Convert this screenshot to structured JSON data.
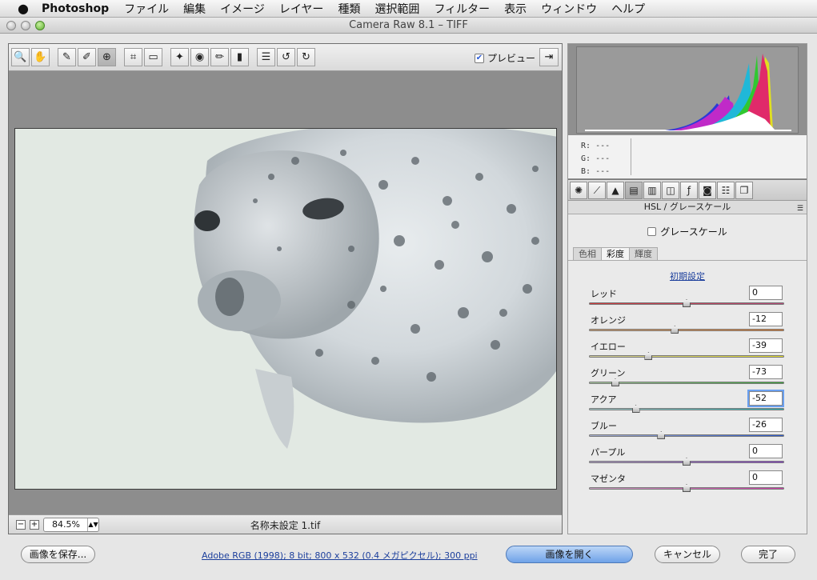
{
  "menubar": {
    "apple": "",
    "app_name": "Photoshop",
    "items": [
      "ファイル",
      "編集",
      "イメージ",
      "レイヤー",
      "種類",
      "選択範囲",
      "フィルター",
      "表示",
      "ウィンドウ",
      "ヘルプ"
    ]
  },
  "window": {
    "title": "Camera Raw 8.1  –  TIFF"
  },
  "toolbar": {
    "preview_label": "プレビュー",
    "preview_checked": true,
    "tools": [
      "zoom-tool",
      "hand-tool",
      "white-balance-tool",
      "color-sampler-tool",
      "targeted-adjustment-tool",
      "crop-tool",
      "straighten-tool",
      "spot-removal-tool",
      "red-eye-tool",
      "adjustment-brush-tool",
      "graduated-filter-tool",
      "radial-filter-tool",
      "preferences",
      "rotate-ccw",
      "rotate-cw"
    ]
  },
  "status": {
    "zoom": "84.5%",
    "filename": "名称未設定 1.tif"
  },
  "readout": {
    "r_label": "R:",
    "g_label": "G:",
    "b_label": "B:",
    "r": "---",
    "g": "---",
    "b": "---"
  },
  "panel": {
    "title": "HSL / グレースケール",
    "grayscale_label": "グレースケール",
    "grayscale_checked": false,
    "subtabs": [
      "色相",
      "彩度",
      "輝度"
    ],
    "active_subtab": "彩度",
    "defaults_link": "初期設定",
    "sliders": [
      {
        "label": "レッド",
        "value": "0",
        "gradient": [
          "#d23a3a",
          "#b84a7a"
        ]
      },
      {
        "label": "オレンジ",
        "value": "-12",
        "gradient": [
          "#d0a070",
          "#e07a2a"
        ]
      },
      {
        "label": "イエロー",
        "value": "-39",
        "gradient": [
          "#d4d0a0",
          "#e8e02a"
        ]
      },
      {
        "label": "グリーン",
        "value": "-73",
        "gradient": [
          "#a8c8a0",
          "#3aa83a"
        ]
      },
      {
        "label": "アクア",
        "value": "-52",
        "gradient": [
          "#a8c8c8",
          "#2ab0b0"
        ]
      },
      {
        "label": "ブルー",
        "value": "-26",
        "gradient": [
          "#a8b0d0",
          "#2a5ad0"
        ]
      },
      {
        "label": "パープル",
        "value": "0",
        "gradient": [
          "#b0a0c8",
          "#8a3ad0"
        ]
      },
      {
        "label": "マゼンタ",
        "value": "0",
        "gradient": [
          "#c8a0c0",
          "#d03aa8"
        ]
      }
    ]
  },
  "buttons": {
    "save": "画像を保存...",
    "open": "画像を開く",
    "cancel": "キャンセル",
    "done": "完了"
  },
  "workflow_link": "Adobe RGB (1998); 8 bit; 800 x 532 (0.4 メガピクセル); 300 ppi"
}
